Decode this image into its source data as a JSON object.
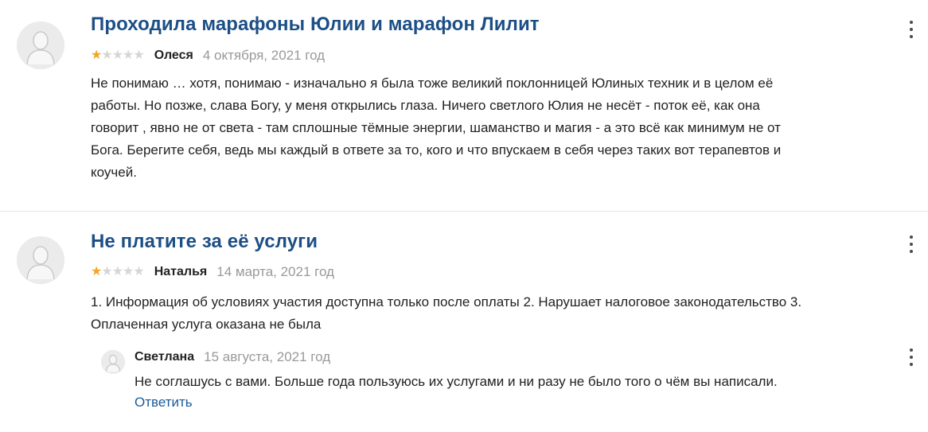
{
  "reviews": [
    {
      "title": "Проходила марафоны Юлии и марафон Лилит",
      "author": "Олеся",
      "date": "4 октября, 2021 год",
      "rating": 1,
      "rating_max": 5,
      "text_lines": [
        "Не понимаю … хотя, понимаю - изначально я была тоже великий поклонницей Юлиных техник и в целом её",
        "работы. Но позже, слава Богу, у меня открылись глаза. Ничего светлого Юлия не несёт - поток её, как она",
        "говорит , явно не от света - там сплошные тёмные энергии, шаманство и магия - а это всё как минимум не от",
        "Бога. Берегите себя, ведь мы каждый в ответе за то, кого и что впускаем в себя через таких вот терапевтов и",
        "коучей."
      ]
    },
    {
      "title": "Не платите за её услуги",
      "author": "Наталья",
      "date": "14 марта, 2021 год",
      "rating": 1,
      "rating_max": 5,
      "text_lines": [
        "1. Информация об условиях участия доступна только после оплаты 2. Нарушает налоговое законодательство 3.",
        "Оплаченная услуга оказана не была"
      ],
      "reply": {
        "author": "Светлана",
        "date": "15 августа, 2021 год",
        "text": "Не соглашусь с вами. Больше года пользуюсь их услугами и ни разу не было того о чём вы написали.",
        "reply_link": "Ответить"
      }
    }
  ],
  "colors": {
    "title": "#1c4f86",
    "star_filled": "#f2a623",
    "star_empty": "#d6d6d6",
    "date": "#999999",
    "link": "#1c5a9a"
  },
  "icons": {
    "avatar": "user-silhouette-icon",
    "menu": "kebab-menu-icon"
  }
}
